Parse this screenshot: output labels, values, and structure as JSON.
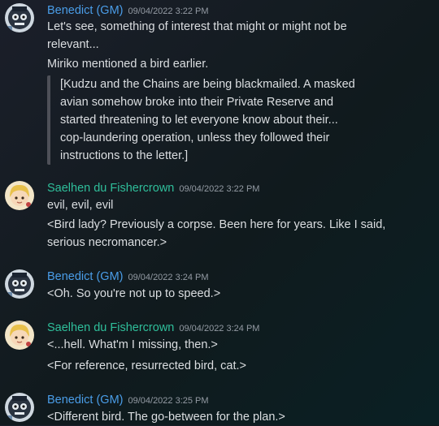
{
  "colors": {
    "gm_name": "#4a9de8",
    "saelhen_name": "#2fbf9b",
    "timestamp": "#949ba4",
    "text": "#dbdee1",
    "quote_bar": "#4e5058"
  },
  "messages": [
    {
      "author": "Benedict (GM)",
      "timestamp": "09/04/2022 3:22 PM",
      "avatar_icon": "skull-mask-avatar-icon",
      "lines": [
        "Let's see, something of interest that might or might not be",
        "relevant...",
        "Miriko mentioned a bird earlier."
      ],
      "quote": [
        "[Kudzu and the Chains are being blackmailed. A masked",
        "avian somehow broke into their Private Reserve and",
        "started threatening to let everyone know about their...",
        "cop-laundering operation, unless they followed their",
        "instructions to the letter.]"
      ]
    },
    {
      "author": "Saelhen du Fishercrown",
      "timestamp": "09/04/2022 3:22 PM",
      "avatar_icon": "blonde-character-avatar-icon",
      "lines": [
        "evil, evil, evil",
        "<Bird lady? Previously a corpse. Been here for years. Like I said,",
        "serious necromancer.>"
      ]
    },
    {
      "author": "Benedict (GM)",
      "timestamp": "09/04/2022 3:24 PM",
      "avatar_icon": "skull-mask-avatar-icon",
      "lines": [
        "<Oh. So you're not up to speed.>"
      ]
    },
    {
      "author": "Saelhen du Fishercrown",
      "timestamp": "09/04/2022 3:24 PM",
      "avatar_icon": "blonde-character-avatar-icon",
      "lines": [
        "<...hell. What'm I missing, then.>",
        "<For reference, resurrected bird, cat.>"
      ]
    },
    {
      "author": "Benedict (GM)",
      "timestamp": "09/04/2022 3:25 PM",
      "avatar_icon": "skull-mask-avatar-icon",
      "lines": [
        "<Different bird. The go-between for the plan.>"
      ]
    }
  ]
}
